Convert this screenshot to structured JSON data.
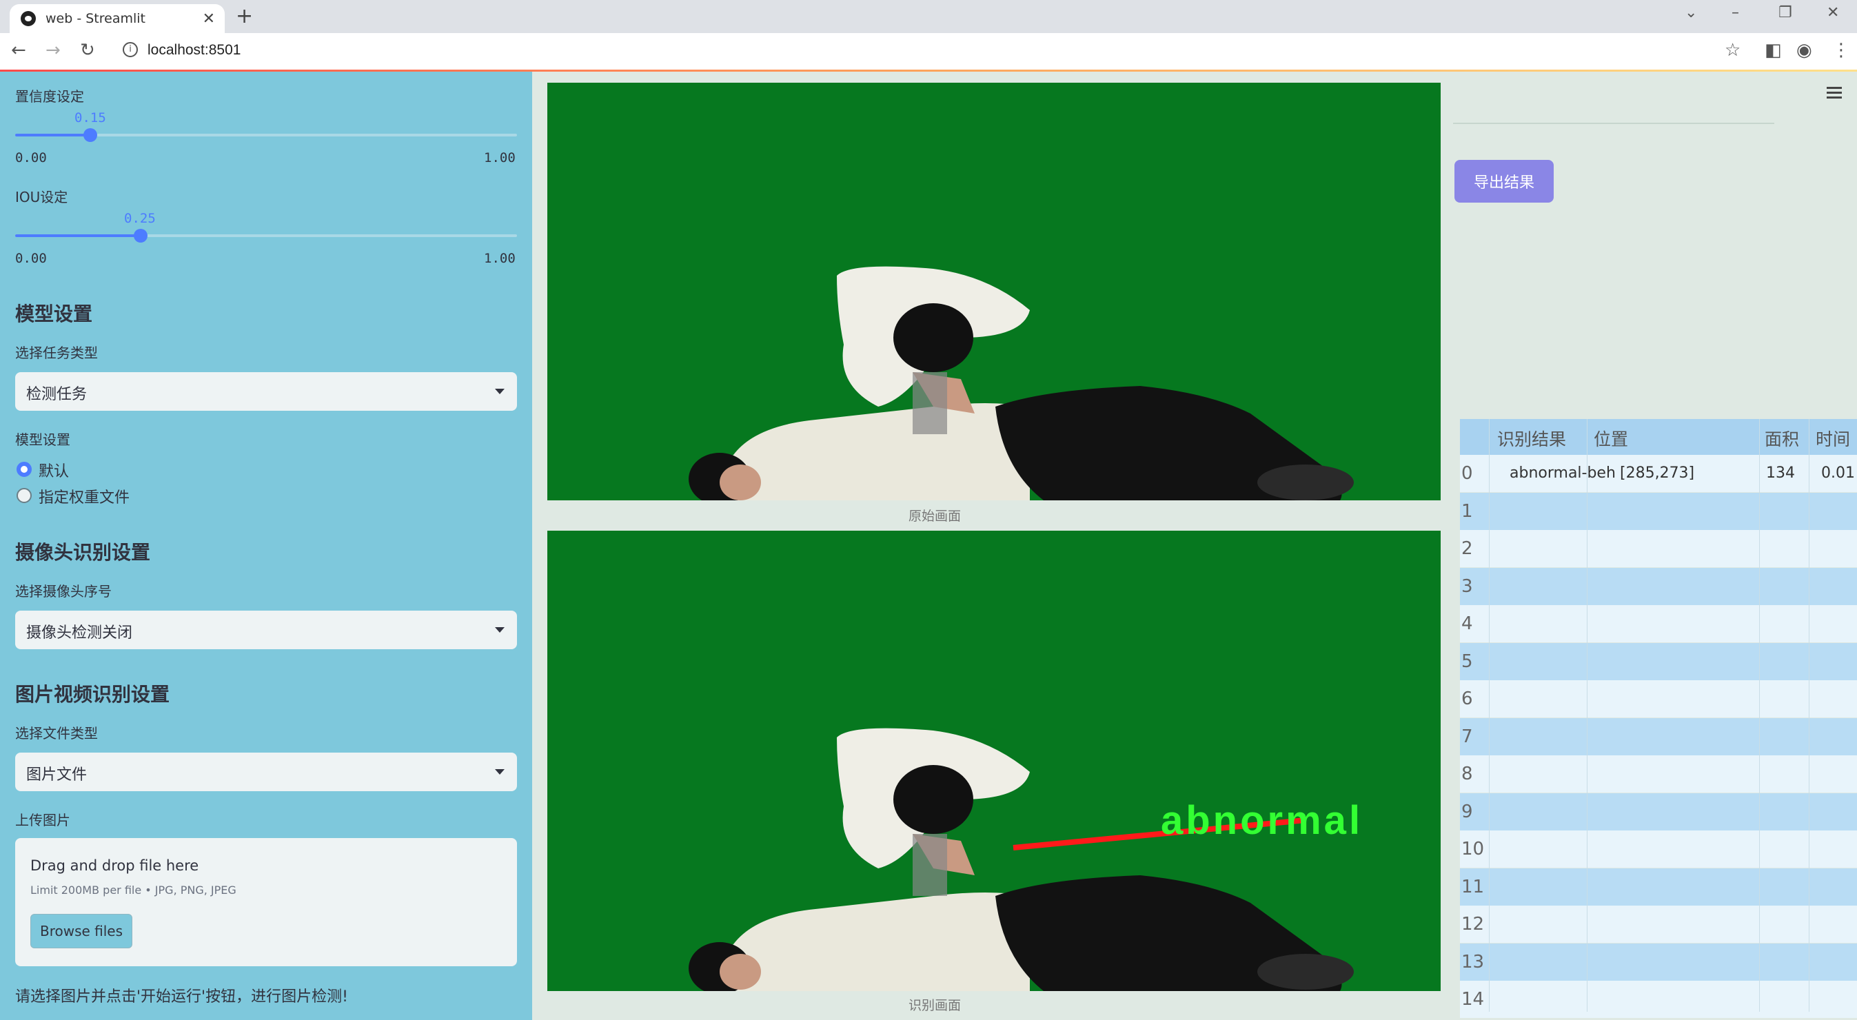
{
  "browser": {
    "tab_title": "web - Streamlit",
    "url": "localhost:8501"
  },
  "sidebar": {
    "confidence": {
      "label": "置信度设定",
      "value": "0.15",
      "value_fraction": 0.15,
      "min": "0.00",
      "max": "1.00"
    },
    "iou": {
      "label": "IOU设定",
      "value": "0.25",
      "value_fraction": 0.25,
      "min": "0.00",
      "max": "1.00"
    },
    "model_section": "模型设置",
    "task_label": "选择任务类型",
    "task_value": "检测任务",
    "model_label": "模型设置",
    "model_options": [
      "默认",
      "指定权重文件"
    ],
    "model_selected": "默认",
    "camera_section": "摄像头识别设置",
    "camera_label": "选择摄像头序号",
    "camera_value": "摄像头检测关闭",
    "media_section": "图片视频识别设置",
    "file_type_label": "选择文件类型",
    "file_type_value": "图片文件",
    "upload_label": "上传图片",
    "dropzone": {
      "title": "Drag and drop file here",
      "limit": "Limit 200MB per file • JPG, PNG, JPEG",
      "button": "Browse files"
    },
    "hint": "请选择图片并点击'开始运行'按钮，进行图片检测!"
  },
  "main": {
    "original_caption": "原始画面",
    "result_caption": "识别画面",
    "detection_label": "abnormal"
  },
  "right": {
    "export_button": "导出结果",
    "table": {
      "headers": [
        "识别结果",
        "位置",
        "面积",
        "时间"
      ],
      "rows": [
        {
          "index": "0",
          "result": "abnormal-beh",
          "position": "[285,273]",
          "area": "134",
          "time": "0.01"
        },
        {
          "index": "1"
        },
        {
          "index": "2"
        },
        {
          "index": "3"
        },
        {
          "index": "4"
        },
        {
          "index": "5"
        },
        {
          "index": "6"
        },
        {
          "index": "7"
        },
        {
          "index": "8"
        },
        {
          "index": "9"
        },
        {
          "index": "10"
        },
        {
          "index": "11"
        },
        {
          "index": "12"
        },
        {
          "index": "13"
        },
        {
          "index": "14"
        }
      ]
    }
  },
  "colors": {
    "accent": "#4d7cff",
    "sidebar_bg": "#7ec8dc",
    "green_screen": "#06781f",
    "export_btn": "#8a86e6",
    "table_header": "#a8d2f0"
  }
}
